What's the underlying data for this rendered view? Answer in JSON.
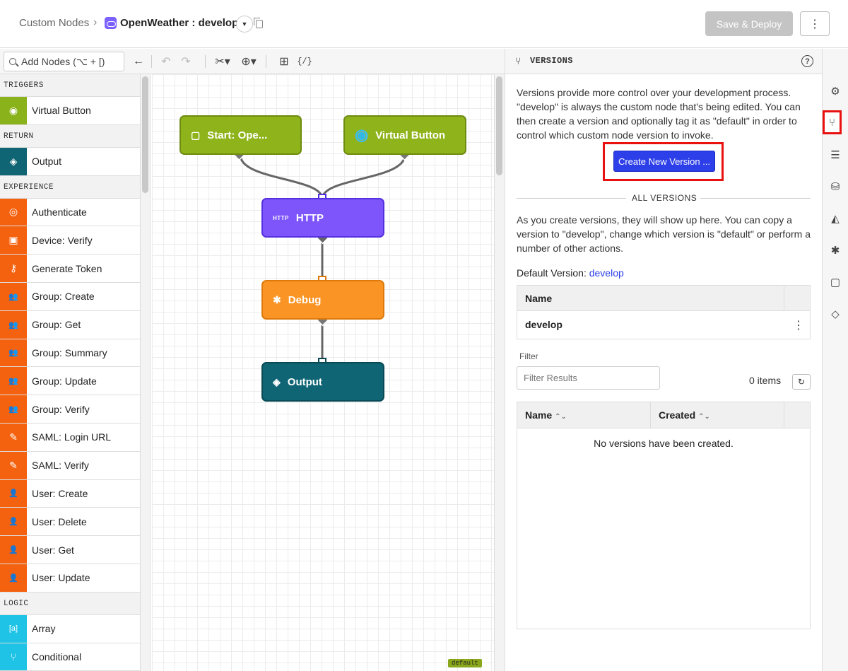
{
  "header": {
    "breadcrumb": "Custom Nodes",
    "separator": "›",
    "app_name": "OpenWeather : develop",
    "save_label": "Save & Deploy",
    "more_label": "⋮"
  },
  "toolbar": {
    "search_placeholder": "Add Nodes (⌥ + [)"
  },
  "palette": {
    "categories": [
      {
        "label": "TRIGGERS",
        "items": [
          {
            "label": "Virtual Button",
            "color": "#89b21b",
            "icon": "virtual-button-icon",
            "glyph": "◉"
          }
        ]
      },
      {
        "label": "RETURN",
        "items": [
          {
            "label": "Output",
            "color": "#0f6574",
            "icon": "output-icon",
            "glyph": "◈"
          }
        ]
      },
      {
        "label": "EXPERIENCE",
        "items": [
          {
            "label": "Authenticate",
            "color": "#f5620f",
            "icon": "fingerprint-icon",
            "glyph": "◎"
          },
          {
            "label": "Device: Verify",
            "color": "#f5620f",
            "icon": "chip-icon",
            "glyph": "▣"
          },
          {
            "label": "Generate Token",
            "color": "#f5620f",
            "icon": "key-icon",
            "glyph": "⚷"
          },
          {
            "label": "Group: Create",
            "color": "#f5620f",
            "icon": "group-add-icon",
            "glyph": "👥"
          },
          {
            "label": "Group: Get",
            "color": "#f5620f",
            "icon": "group-search-icon",
            "glyph": "👥"
          },
          {
            "label": "Group: Summary",
            "color": "#f5620f",
            "icon": "group-list-icon",
            "glyph": "👥"
          },
          {
            "label": "Group: Update",
            "color": "#f5620f",
            "icon": "group-edit-icon",
            "glyph": "👥"
          },
          {
            "label": "Group: Verify",
            "color": "#f5620f",
            "icon": "group-icon",
            "glyph": "👥"
          },
          {
            "label": "SAML: Login URL",
            "color": "#f5620f",
            "icon": "saml-icon",
            "glyph": "✎"
          },
          {
            "label": "SAML: Verify",
            "color": "#f5620f",
            "icon": "saml-verify-icon",
            "glyph": "✎"
          },
          {
            "label": "User: Create",
            "color": "#f5620f",
            "icon": "user-add-icon",
            "glyph": "👤"
          },
          {
            "label": "User: Delete",
            "color": "#f5620f",
            "icon": "user-remove-icon",
            "glyph": "👤"
          },
          {
            "label": "User: Get",
            "color": "#f5620f",
            "icon": "user-search-icon",
            "glyph": "👤"
          },
          {
            "label": "User: Update",
            "color": "#f5620f",
            "icon": "user-edit-icon",
            "glyph": "👤"
          }
        ]
      },
      {
        "label": "LOGIC",
        "items": [
          {
            "label": "Array",
            "color": "#1ec3e6",
            "icon": "array-icon",
            "glyph": "[a]"
          },
          {
            "label": "Conditional",
            "color": "#1ec3e6",
            "icon": "branch-icon",
            "glyph": "⑂"
          }
        ]
      }
    ]
  },
  "canvas": {
    "nodes": [
      {
        "id": "start",
        "label": "Start: Ope...",
        "color": "#8fb31b",
        "border": "#6f8c12",
        "icon": "square-icon",
        "glyph": "▢"
      },
      {
        "id": "vb",
        "label": "Virtual Button",
        "color": "#8fb31b",
        "border": "#6f8c12",
        "icon": "virtual-button-icon",
        "glyph": "◉"
      },
      {
        "id": "http",
        "label": "HTTP",
        "color": "#7d55fb",
        "border": "#5431e0",
        "icon": "http-icon",
        "glyph": "HTTP"
      },
      {
        "id": "debug",
        "label": "Debug",
        "color": "#fa9424",
        "border": "#de7a0c",
        "icon": "bug-icon",
        "glyph": "✱"
      },
      {
        "id": "output",
        "label": "Output",
        "color": "#0f6574",
        "border": "#094a55",
        "icon": "output-icon",
        "glyph": "◈"
      }
    ],
    "badge": "default"
  },
  "panel": {
    "title": "VERSIONS",
    "description": "Versions provide more control over your development process. \"develop\" is always the custom node that's being edited. You can then create a version and optionally tag it as \"default\" in order to control which custom node version to invoke.",
    "create_label": "Create New Version ...",
    "all_versions_label": "ALL VERSIONS",
    "description2": "As you create versions, they will show up here. You can copy a version to \"develop\", change which version is \"default\" or perform a number of other actions.",
    "default_version_label": "Default Version:",
    "default_version_value": "develop",
    "table1": {
      "col_name": "Name",
      "rows": [
        {
          "name": "develop"
        }
      ]
    },
    "filter_label": "Filter",
    "filter_placeholder": "Filter Results",
    "items_count": "0 items",
    "table2": {
      "col_name": "Name",
      "col_created": "Created",
      "empty": "No versions have been created."
    }
  },
  "rail": {
    "icons": [
      "gear-icon",
      "branch-icon",
      "list-icon",
      "database-icon",
      "chart-icon",
      "bug-icon",
      "square-icon",
      "diamond-icon"
    ]
  }
}
